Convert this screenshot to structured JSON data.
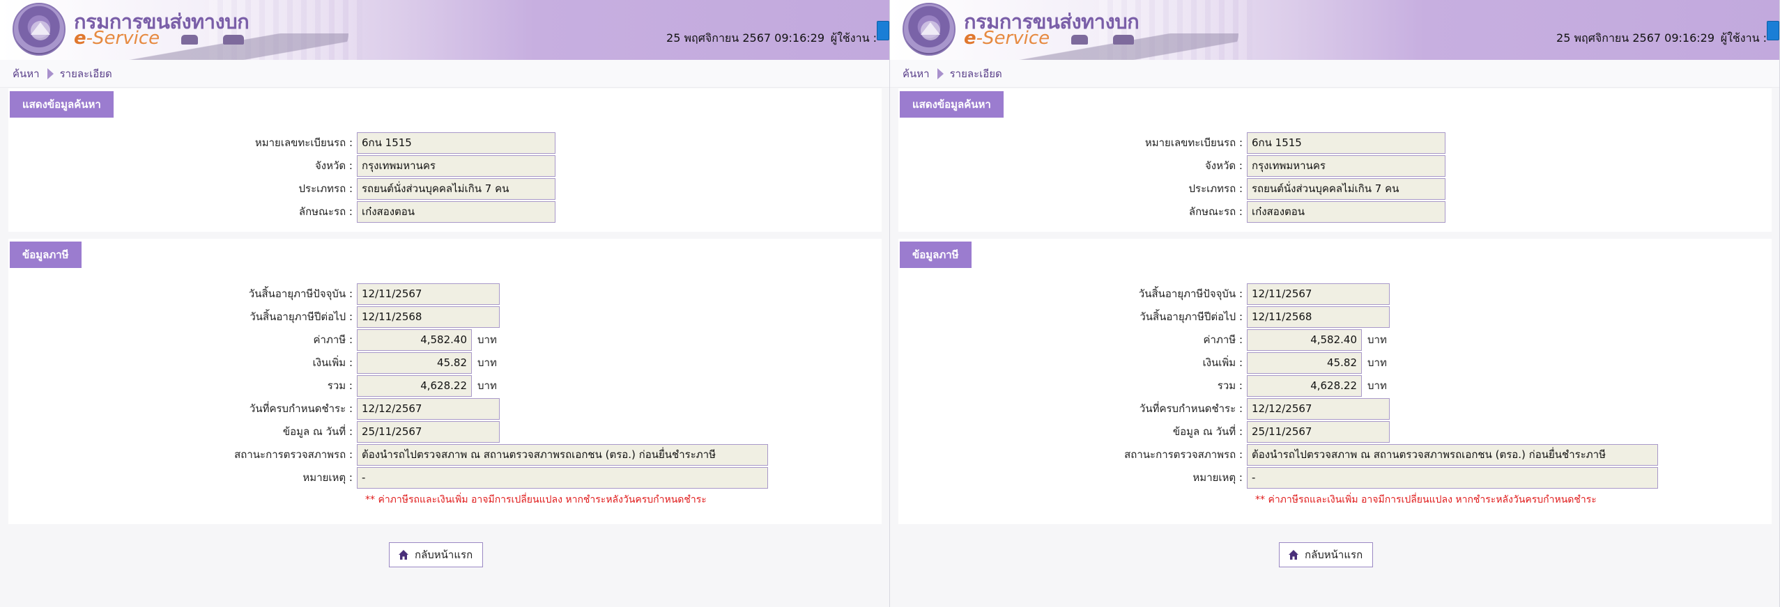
{
  "header": {
    "title": "กรมการขนส่งทางบก",
    "subtitle_e": "e",
    "subtitle_service": "-Service",
    "datetime": "25 พฤศจิกายน 2567 09:16:29",
    "user_label": "ผู้ใช้งาน :"
  },
  "breadcrumb": {
    "search": "ค้นหา",
    "detail": "รายละเอียด"
  },
  "search_section": {
    "title": "แสดงข้อมูลค้นหา",
    "fields": [
      {
        "label": "หมายเลขทะเบียนรถ :",
        "value": "6กน 1515"
      },
      {
        "label": "จังหวัด :",
        "value": "กรุงเทพมหานคร"
      },
      {
        "label": "ประเภทรถ :",
        "value": "รถยนต์นั่งส่วนบุคคลไม่เกิน 7 คน"
      },
      {
        "label": "ลักษณะรถ :",
        "value": "เก๋งสองตอน"
      }
    ]
  },
  "tax_section": {
    "title": "ข้อมูลภาษี",
    "expiry_current_label": "วันสิ้นอายุภาษีปัจจุบัน :",
    "expiry_current": "12/11/2567",
    "expiry_next_label": "วันสิ้นอายุภาษีปีต่อไป :",
    "expiry_next": "12/11/2568",
    "tax_label": "ค่าภาษี :",
    "tax": "4,582.40",
    "surcharge_label": "เงินเพิ่ม :",
    "surcharge": "45.82",
    "total_label": "รวม :",
    "total": "4,628.22",
    "currency": "บาท",
    "due_label": "วันที่ครบกำหนดชำระ :",
    "due": "12/12/2567",
    "asof_label": "ข้อมูล ณ วันที่ :",
    "asof": "25/11/2567",
    "inspection_label": "สถานะการตรวจสภาพรถ :",
    "inspection": "ต้องนำรถไปตรวจสภาพ ณ สถานตรวจสภาพรถเอกชน (ตรอ.) ก่อนยื่นชำระภาษี",
    "remark_label": "หมายเหตุ :",
    "remark": "-",
    "note": "** ค่าภาษีรถและเงินเพิ่ม อาจมีการเปลี่ยนแปลง หากชำระหลังวันครบกำหนดชำระ"
  },
  "home_button": "กลับหน้าแรก",
  "colors": {
    "accent": "#9b7ccf",
    "field_bg": "#f0efe3",
    "warning": "#e01b1b",
    "link": "#5a3f8a"
  }
}
